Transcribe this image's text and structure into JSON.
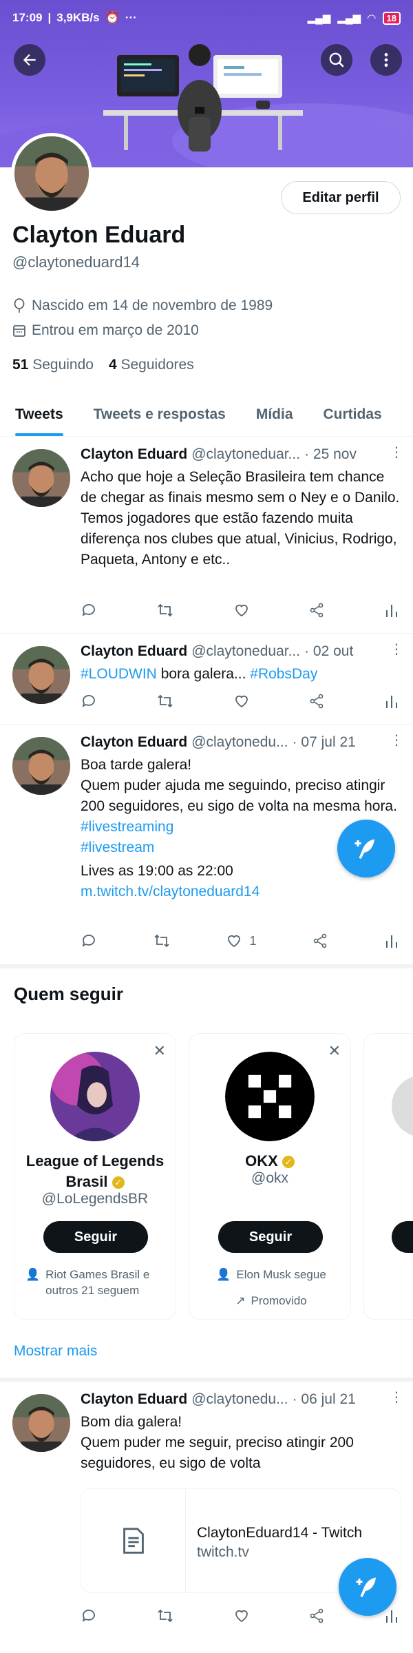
{
  "status": {
    "time": "17:09",
    "speed": "3,9KB/s",
    "battery": "18"
  },
  "profile": {
    "name": "Clayton Eduard",
    "handle": "@claytoneduard14",
    "edit_label": "Editar perfil",
    "born": "Nascido em 14 de novembro de 1989",
    "joined": "Entrou em março de 2010",
    "following_count": "51",
    "following_label": "Seguindo",
    "followers_count": "4",
    "followers_label": "Seguidores"
  },
  "tabs": [
    "Tweets",
    "Tweets e respostas",
    "Mídia",
    "Curtidas"
  ],
  "tweets": [
    {
      "name": "Clayton Eduard",
      "user": "@claytoneduar...",
      "date": "· 25 nov",
      "text": "Acho que hoje a Seleção Brasileira tem chance de chegar as finais mesmo sem o Ney e o Danilo. Temos jogadores que estão fazendo muita diferença nos clubes que atual, Vinicius, Rodrigo, Paqueta, Antony e etc.."
    },
    {
      "name": "Clayton Eduard",
      "user": "@claytoneduar...",
      "date": "· 02 out",
      "tag1": "#LOUDWIN",
      "mid": " bora galera... ",
      "tag2": "#RobsDay"
    },
    {
      "name": "Clayton Eduard",
      "user": "@claytonedu...",
      "date": "· 07 jul 21",
      "line1": "Boa tarde galera!",
      "line2": "Quem puder ajuda me seguindo, preciso atingir 200 seguidores, eu sigo de volta na mesma hora.",
      "tag1": "#livestreaming",
      "tag2": "#livestream",
      "line3": "Lives as 19:00 as 22:00",
      "url": "m.twitch.tv/claytoneduard14",
      "likes": "1"
    },
    {
      "name": "Clayton Eduard",
      "user": "@claytonedu...",
      "date": "· 06 jul 21",
      "line1": "Bom dia galera!",
      "line2": "Quem puder me seguir, preciso atingir 200 seguidores, eu sigo de volta",
      "card_title": "ClaytonEduard14 - Twitch",
      "card_domain": "twitch.tv"
    }
  ],
  "who_to_follow": {
    "title": "Quem seguir",
    "follow_label": "Seguir",
    "more_label": "Mostrar mais",
    "cards": [
      {
        "name": "League of Legends Brasil",
        "handle": "@LoLegendsBR",
        "foot": "Riot Games Brasil e outros 21 seguem"
      },
      {
        "name": "OKX",
        "handle": "@okx",
        "foot": "Elon Musk segue",
        "promo": "Promovido"
      }
    ]
  },
  "colors": {
    "accent": "#1d9bf0",
    "banner": "#7a5ee0",
    "text": "#0f1419",
    "muted": "#536471"
  }
}
